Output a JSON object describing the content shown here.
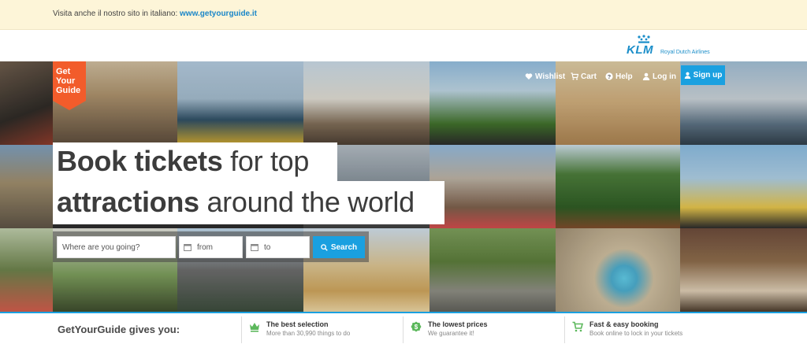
{
  "banner": {
    "prefix": "Visita anche il nostro sito in italiano:",
    "link": "www.getyourguide.it"
  },
  "partner": {
    "brand": "KLM",
    "tagline": "Royal Dutch Airlines"
  },
  "logo": {
    "line1": "Get",
    "line2": "Your",
    "line3": "Guide"
  },
  "nav": {
    "wishlist": "Wishlist",
    "cart": "Cart",
    "help": "Help",
    "login": "Log in",
    "signup": "Sign up"
  },
  "hero": {
    "line1_bold": "Book tickets",
    "line1_rest": " for top",
    "line2_bold": "attractions",
    "line2_rest": " around the world"
  },
  "search": {
    "where_placeholder": "Where are you going?",
    "from_label": "from",
    "to_label": "to",
    "button": "Search"
  },
  "benefits": {
    "heading": "GetYourGuide gives you:",
    "items": [
      {
        "title": "The best selection",
        "desc": "More than 30,990 things to do",
        "icon": "crown-icon"
      },
      {
        "title": "The lowest prices",
        "desc": "We guarantee it!",
        "icon": "dollar-badge-icon"
      },
      {
        "title": "Fast & easy booking",
        "desc": "Book online to lock in your tickets",
        "icon": "cart-icon"
      }
    ]
  },
  "colors": {
    "accent": "#1aa0e0",
    "brand_orange": "#f25c2b",
    "banner_bg": "#fdf5d8",
    "benefit_icon": "#5cb85c"
  }
}
